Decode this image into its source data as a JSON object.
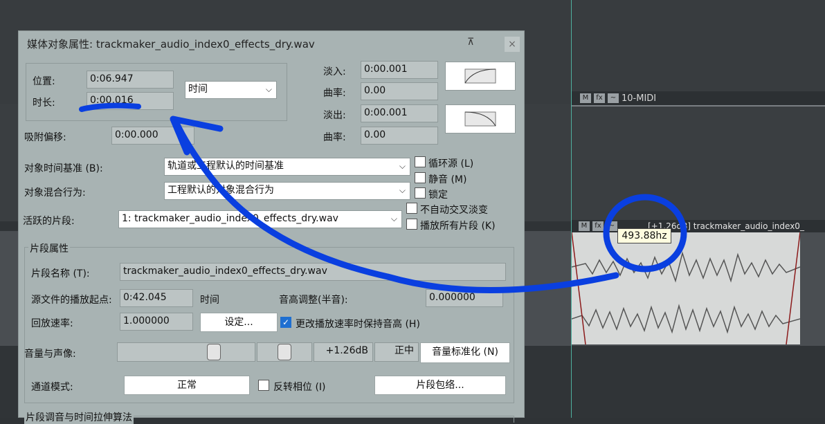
{
  "dialog": {
    "title": "媒体对象属性: trackmaker_audio_index0_effects_dry.wav",
    "position_label": "位置:",
    "position_value": "0:06.947",
    "length_label": "时长:",
    "length_value": "0:00.016",
    "time_format": "时间",
    "fadein_label": "淡入:",
    "fadein_value": "0:00.001",
    "fadein_curve_label": "曲率:",
    "fadein_curve_value": "0.00",
    "fadeout_label": "淡出:",
    "fadeout_value": "0:00.001",
    "fadeout_curve_label": "曲率:",
    "fadeout_curve_value": "0.00",
    "snap_label": "吸附偏移:",
    "snap_value": "0:00.000",
    "timebase_label": "对象时间基准 (B):",
    "timebase_value": "轨道或工程默认的时间基准",
    "blend_label": "对象混合行为:",
    "blend_value": "工程默认的对象混合行为",
    "active_take_label": "活跃的片段:",
    "active_take_value": "1: trackmaker_audio_index0_effects_dry.wav",
    "loop_label": "循环源 (L)",
    "mute_label": "静音 (M)",
    "lock_label": "锁定",
    "no_autocross_label": "不自动交叉淡变",
    "play_all_takes_label": "播放所有片段 (K)",
    "take_group_label": "片段属性",
    "take_name_label": "片段名称 (T):",
    "take_name_value": "trackmaker_audio_index0_effects_dry.wav",
    "start_offset_label": "源文件的播放起点:",
    "start_offset_value": "0:42.045",
    "start_offset_unit": "时间",
    "pitch_label": "音高调整(半音):",
    "pitch_value": "0.000000",
    "rate_label": "回放速率:",
    "rate_value": "1.000000",
    "rate_set_button": "设定...",
    "preserve_pitch_label": "更改播放速率时保持音高 (H)",
    "vol_pan_label": "音量与声像:",
    "volume_db": "+1.26dB",
    "pan_value": "正中",
    "normalize_button": "音量标准化 (N)",
    "channel_mode_label": "通道模式:",
    "channel_mode_value": "正常",
    "invert_phase_label": "反转相位 (I)",
    "take_envelopes_button": "片段包络...",
    "bottom_group_label": "片段调音与时间拉伸算法"
  },
  "tracks": {
    "midi_track_name": "10-MIDI",
    "clip_label": "[+1.26dB] trackmaker_audio_index0_"
  },
  "tooltip": {
    "frequency": "493.88hz"
  },
  "annotation": {
    "color": "#0a3fe0"
  }
}
